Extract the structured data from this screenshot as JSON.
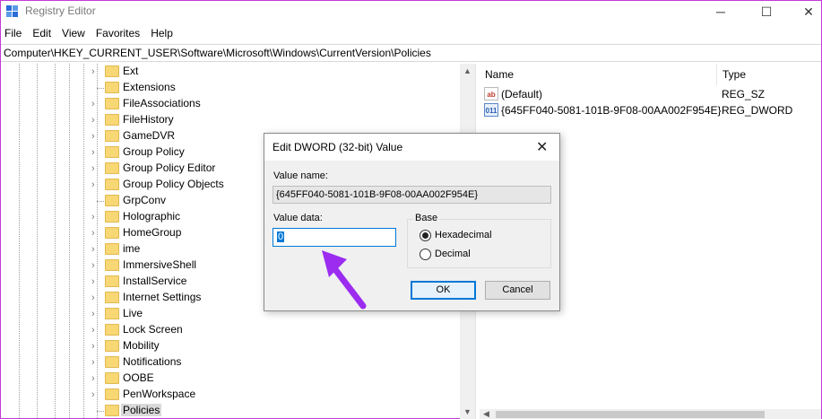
{
  "window": {
    "title": "Registry Editor",
    "controls": {
      "minimize": "─",
      "maximize": "☐",
      "close": "✕"
    }
  },
  "menu": [
    "File",
    "Edit",
    "View",
    "Favorites",
    "Help"
  ],
  "address": "Computer\\HKEY_CURRENT_USER\\Software\\Microsoft\\Windows\\CurrentVersion\\Policies",
  "tree": {
    "items": [
      {
        "label": "Ext",
        "expandable": true
      },
      {
        "label": "Extensions",
        "expandable": false
      },
      {
        "label": "FileAssociations",
        "expandable": true
      },
      {
        "label": "FileHistory",
        "expandable": true
      },
      {
        "label": "GameDVR",
        "expandable": true
      },
      {
        "label": "Group Policy",
        "expandable": true
      },
      {
        "label": "Group Policy Editor",
        "expandable": true
      },
      {
        "label": "Group Policy Objects",
        "expandable": true
      },
      {
        "label": "GrpConv",
        "expandable": false
      },
      {
        "label": "Holographic",
        "expandable": true
      },
      {
        "label": "HomeGroup",
        "expandable": true
      },
      {
        "label": "ime",
        "expandable": true
      },
      {
        "label": "ImmersiveShell",
        "expandable": true
      },
      {
        "label": "InstallService",
        "expandable": true
      },
      {
        "label": "Internet Settings",
        "expandable": true
      },
      {
        "label": "Live",
        "expandable": true
      },
      {
        "label": "Lock Screen",
        "expandable": true
      },
      {
        "label": "Mobility",
        "expandable": true
      },
      {
        "label": "Notifications",
        "expandable": true
      },
      {
        "label": "OOBE",
        "expandable": true
      },
      {
        "label": "PenWorkspace",
        "expandable": true
      },
      {
        "label": "Policies",
        "expandable": false,
        "selected": true
      }
    ]
  },
  "list": {
    "columns": {
      "name": "Name",
      "type": "Type"
    },
    "rows": [
      {
        "name": "(Default)",
        "type": "REG_SZ",
        "icon": "ab"
      },
      {
        "name": "{645FF040-5081-101B-9F08-00AA002F954E}",
        "type": "REG_DWORD",
        "icon": "011"
      }
    ]
  },
  "dialog": {
    "title": "Edit DWORD (32-bit) Value",
    "value_name_label": "Value name:",
    "value_name": "{645FF040-5081-101B-9F08-00AA002F954E}",
    "value_data_label": "Value data:",
    "value_data": "0",
    "base_label": "Base",
    "radio_hex": "Hexadecimal",
    "radio_dec": "Decimal",
    "base_selected": "Hexadecimal",
    "ok": "OK",
    "cancel": "Cancel"
  },
  "colors": {
    "annotation_arrow": "#9b2cf0",
    "window_border": "#c23bd5",
    "focus_blue": "#0078d7"
  }
}
